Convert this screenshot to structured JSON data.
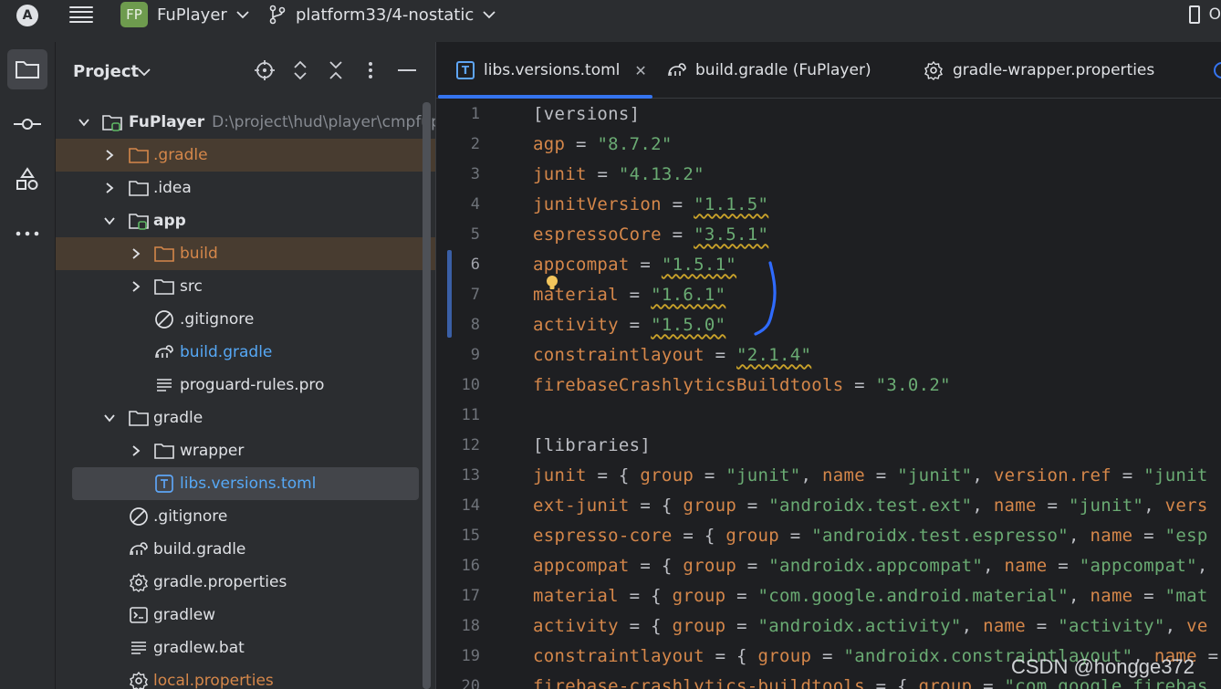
{
  "titlebar": {
    "app_icon_letter": "A",
    "project_badge": "FP",
    "project_name": "FuPlayer",
    "branch": "platform33/4-nostatic",
    "right_text": "O"
  },
  "project_panel": {
    "title": "Project",
    "tree": [
      {
        "label": "FuPlayer",
        "hint": "D:\\project\\hud\\player\\cmpfupl",
        "icon": "module-folder-icon",
        "expanded": true
      },
      {
        "label": ".gradle",
        "icon": "folder-icon",
        "expanded": false
      },
      {
        "label": ".idea",
        "icon": "folder-icon",
        "expanded": false
      },
      {
        "label": "app",
        "icon": "module-folder-icon",
        "expanded": true
      },
      {
        "label": "build",
        "icon": "folder-icon",
        "expanded": false
      },
      {
        "label": "src",
        "icon": "folder-icon",
        "expanded": false
      },
      {
        "label": ".gitignore",
        "icon": "ignore-file-icon"
      },
      {
        "label": "build.gradle",
        "icon": "gradle-icon"
      },
      {
        "label": "proguard-rules.pro",
        "icon": "text-file-icon"
      },
      {
        "label": "gradle",
        "icon": "folder-icon",
        "expanded": true
      },
      {
        "label": "wrapper",
        "icon": "folder-icon",
        "expanded": false
      },
      {
        "label": "libs.versions.toml",
        "icon": "toml-file-icon"
      },
      {
        "label": ".gitignore",
        "icon": "ignore-file-icon"
      },
      {
        "label": "build.gradle",
        "icon": "gradle-icon"
      },
      {
        "label": "gradle.properties",
        "icon": "gear-icon"
      },
      {
        "label": "gradlew",
        "icon": "terminal-icon"
      },
      {
        "label": "gradlew.bat",
        "icon": "text-file-icon"
      },
      {
        "label": "local.properties",
        "icon": "gear-icon"
      }
    ]
  },
  "editor": {
    "tabs": [
      {
        "label": "libs.versions.toml",
        "active": true
      },
      {
        "label": "build.gradle (FuPlayer)",
        "active": false
      },
      {
        "label": "gradle-wrapper.properties",
        "active": false
      }
    ],
    "line_numbers": [
      "1",
      "2",
      "3",
      "4",
      "5",
      "6",
      "7",
      "8",
      "9",
      "10",
      "11",
      "12",
      "13",
      "14",
      "15",
      "16",
      "17",
      "18",
      "19",
      "20"
    ],
    "lines": [
      [
        {
          "t": "[versions]",
          "c": "o"
        }
      ],
      [
        {
          "t": "agp",
          "c": "k2"
        },
        {
          "t": " = ",
          "c": "o"
        },
        {
          "t": "\"8.7.2\"",
          "c": "s"
        }
      ],
      [
        {
          "t": "junit",
          "c": "k2"
        },
        {
          "t": " = ",
          "c": "o"
        },
        {
          "t": "\"4.13.2\"",
          "c": "s"
        }
      ],
      [
        {
          "t": "junitVersion",
          "c": "k2"
        },
        {
          "t": " = ",
          "c": "o"
        },
        {
          "t": "\"1.1.5\"",
          "c": "s warn"
        }
      ],
      [
        {
          "t": "espressoCore",
          "c": "k2"
        },
        {
          "t": " = ",
          "c": "o"
        },
        {
          "t": "\"3.5.1\"",
          "c": "s warn"
        }
      ],
      [
        {
          "t": "appcompat",
          "c": "k2"
        },
        {
          "t": " = ",
          "c": "o"
        },
        {
          "t": "\"1.5.1\"",
          "c": "s warn"
        }
      ],
      [
        {
          "t": "material",
          "c": "k2"
        },
        {
          "t": " = ",
          "c": "o"
        },
        {
          "t": "\"1.6.1\"",
          "c": "s warn"
        }
      ],
      [
        {
          "t": "activity",
          "c": "k2"
        },
        {
          "t": " = ",
          "c": "o"
        },
        {
          "t": "\"1.5.0\"",
          "c": "s warn"
        }
      ],
      [
        {
          "t": "constraintlayout",
          "c": "k2"
        },
        {
          "t": " = ",
          "c": "o"
        },
        {
          "t": "\"2.1.4\"",
          "c": "s warn"
        }
      ],
      [
        {
          "t": "firebaseCrashlyticsBuildtools",
          "c": "k2"
        },
        {
          "t": " = ",
          "c": "o"
        },
        {
          "t": "\"3.0.2\"",
          "c": "s"
        }
      ],
      [],
      [
        {
          "t": "[libraries]",
          "c": "o"
        }
      ],
      [
        {
          "t": "junit",
          "c": "k2"
        },
        {
          "t": " = { ",
          "c": "o"
        },
        {
          "t": "group",
          "c": "k2"
        },
        {
          "t": " = ",
          "c": "o"
        },
        {
          "t": "\"junit\"",
          "c": "s"
        },
        {
          "t": ", ",
          "c": "o"
        },
        {
          "t": "name",
          "c": "k2"
        },
        {
          "t": " = ",
          "c": "o"
        },
        {
          "t": "\"junit\"",
          "c": "s"
        },
        {
          "t": ", ",
          "c": "o"
        },
        {
          "t": "version.ref",
          "c": "k2"
        },
        {
          "t": " = ",
          "c": "o"
        },
        {
          "t": "\"junit",
          "c": "s"
        }
      ],
      [
        {
          "t": "ext-junit",
          "c": "k2"
        },
        {
          "t": " = { ",
          "c": "o"
        },
        {
          "t": "group",
          "c": "k2"
        },
        {
          "t": " = ",
          "c": "o"
        },
        {
          "t": "\"androidx.test.ext\"",
          "c": "s"
        },
        {
          "t": ", ",
          "c": "o"
        },
        {
          "t": "name",
          "c": "k2"
        },
        {
          "t": " = ",
          "c": "o"
        },
        {
          "t": "\"junit\"",
          "c": "s"
        },
        {
          "t": ", ",
          "c": "o"
        },
        {
          "t": "vers",
          "c": "k2"
        }
      ],
      [
        {
          "t": "espresso-core",
          "c": "k2"
        },
        {
          "t": " = { ",
          "c": "o"
        },
        {
          "t": "group",
          "c": "k2"
        },
        {
          "t": " = ",
          "c": "o"
        },
        {
          "t": "\"androidx.test.espresso\"",
          "c": "s"
        },
        {
          "t": ", ",
          "c": "o"
        },
        {
          "t": "name",
          "c": "k2"
        },
        {
          "t": " = ",
          "c": "o"
        },
        {
          "t": "\"esp",
          "c": "s"
        }
      ],
      [
        {
          "t": "appcompat",
          "c": "k2"
        },
        {
          "t": " = { ",
          "c": "o"
        },
        {
          "t": "group",
          "c": "k2"
        },
        {
          "t": " = ",
          "c": "o"
        },
        {
          "t": "\"androidx.appcompat\"",
          "c": "s"
        },
        {
          "t": ", ",
          "c": "o"
        },
        {
          "t": "name",
          "c": "k2"
        },
        {
          "t": " = ",
          "c": "o"
        },
        {
          "t": "\"appcompat\"",
          "c": "s"
        },
        {
          "t": ",",
          "c": "o"
        }
      ],
      [
        {
          "t": "material",
          "c": "k2"
        },
        {
          "t": " = { ",
          "c": "o"
        },
        {
          "t": "group",
          "c": "k2"
        },
        {
          "t": " = ",
          "c": "o"
        },
        {
          "t": "\"com.google.android.material\"",
          "c": "s"
        },
        {
          "t": ", ",
          "c": "o"
        },
        {
          "t": "name",
          "c": "k2"
        },
        {
          "t": " = ",
          "c": "o"
        },
        {
          "t": "\"mat",
          "c": "s"
        }
      ],
      [
        {
          "t": "activity",
          "c": "k2"
        },
        {
          "t": " = { ",
          "c": "o"
        },
        {
          "t": "group",
          "c": "k2"
        },
        {
          "t": " = ",
          "c": "o"
        },
        {
          "t": "\"androidx.activity\"",
          "c": "s"
        },
        {
          "t": ", ",
          "c": "o"
        },
        {
          "t": "name",
          "c": "k2"
        },
        {
          "t": " = ",
          "c": "o"
        },
        {
          "t": "\"activity\"",
          "c": "s"
        },
        {
          "t": ", ",
          "c": "o"
        },
        {
          "t": "ve",
          "c": "k2"
        }
      ],
      [
        {
          "t": "constraintlayout",
          "c": "k2"
        },
        {
          "t": " = { ",
          "c": "o"
        },
        {
          "t": "group",
          "c": "k2"
        },
        {
          "t": " = ",
          "c": "o"
        },
        {
          "t": "\"androidx.constraintlayout\"",
          "c": "s"
        },
        {
          "t": ", ",
          "c": "o"
        },
        {
          "t": "name",
          "c": "k2"
        },
        {
          "t": " =",
          "c": "o"
        }
      ],
      [
        {
          "t": "firebase-crashlytics-buildtools",
          "c": "k2"
        },
        {
          "t": " = { ",
          "c": "o"
        },
        {
          "t": "group",
          "c": "k2"
        },
        {
          "t": " = ",
          "c": "o"
        },
        {
          "t": "\"com.google.firebas",
          "c": "s"
        }
      ]
    ],
    "current_line": 6
  },
  "watermark": "CSDN @hongge372",
  "colors": {
    "accent": "#3574f0",
    "string": "#6aab73",
    "key": "#d5874a",
    "annotation": "#2f6bff"
  }
}
